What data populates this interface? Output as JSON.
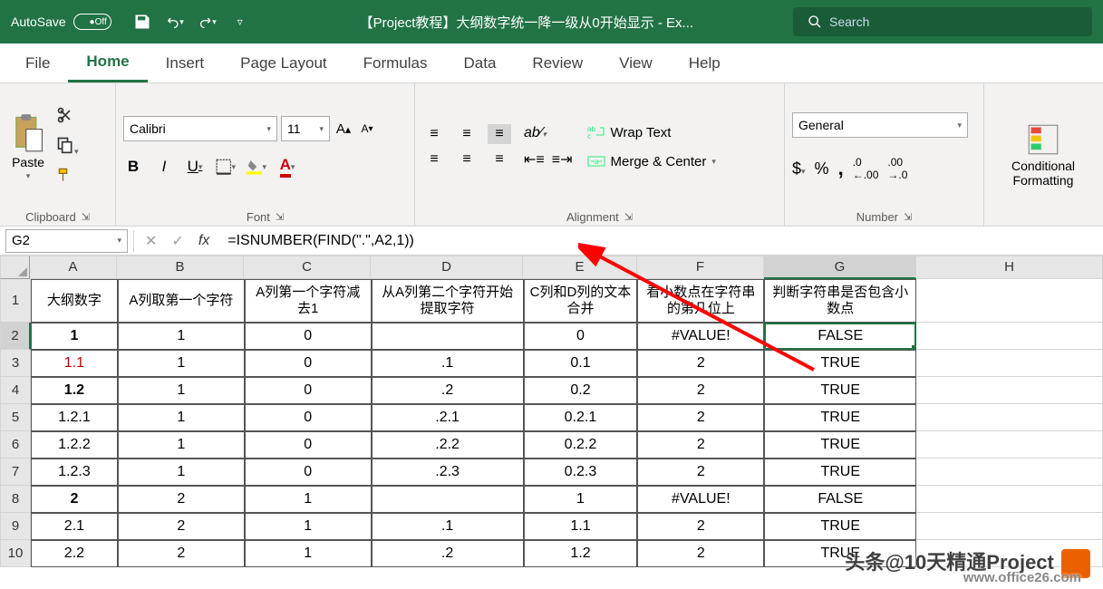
{
  "titlebar": {
    "autosave_label": "AutoSave",
    "autosave_state": "Off",
    "document_title": "【Project教程】大纲数字统一降一级从0开始显示 - Ex...",
    "search_placeholder": "Search"
  },
  "tabs": {
    "file": "File",
    "home": "Home",
    "insert": "Insert",
    "page_layout": "Page Layout",
    "formulas": "Formulas",
    "data": "Data",
    "review": "Review",
    "view": "View",
    "help": "Help"
  },
  "ribbon": {
    "clipboard": {
      "label": "Clipboard",
      "paste": "Paste"
    },
    "font": {
      "label": "Font",
      "name": "Calibri",
      "size": "11"
    },
    "alignment": {
      "label": "Alignment",
      "wrap": "Wrap Text",
      "merge": "Merge & Center"
    },
    "number": {
      "label": "Number",
      "format": "General"
    },
    "styles": {
      "conditional": "Conditional Formatting"
    }
  },
  "formula_bar": {
    "name_box": "G2",
    "formula": "=ISNUMBER(FIND(\".\",A2,1))"
  },
  "columns": {
    "widths": [
      96,
      140,
      140,
      168,
      126,
      140,
      168,
      206
    ],
    "labels": [
      "A",
      "B",
      "C",
      "D",
      "E",
      "F",
      "G",
      "H"
    ]
  },
  "headers": [
    "大纲数字",
    "A列取第一个字符",
    "A列第一个字符减去1",
    "从A列第二个字符开始提取字符",
    "C列和D列的文本合并",
    "看小数点在字符串的第几位上",
    "判断字符串是否包含小数点"
  ],
  "rows": [
    {
      "n": "2",
      "bold": true,
      "red": false,
      "a": "1",
      "b": "1",
      "c": "0",
      "d": "",
      "e": "0",
      "f": "#VALUE!",
      "g": "FALSE",
      "sel": true
    },
    {
      "n": "3",
      "bold": false,
      "red": true,
      "a": "1.1",
      "b": "1",
      "c": "0",
      "d": ".1",
      "e": "0.1",
      "f": "2",
      "g": "TRUE"
    },
    {
      "n": "4",
      "bold": true,
      "red": false,
      "a": "1.2",
      "b": "1",
      "c": "0",
      "d": ".2",
      "e": "0.2",
      "f": "2",
      "g": "TRUE"
    },
    {
      "n": "5",
      "bold": false,
      "red": false,
      "a": "1.2.1",
      "b": "1",
      "c": "0",
      "d": ".2.1",
      "e": "0.2.1",
      "f": "2",
      "g": "TRUE"
    },
    {
      "n": "6",
      "bold": false,
      "red": false,
      "a": "1.2.2",
      "b": "1",
      "c": "0",
      "d": ".2.2",
      "e": "0.2.2",
      "f": "2",
      "g": "TRUE"
    },
    {
      "n": "7",
      "bold": false,
      "red": false,
      "a": "1.2.3",
      "b": "1",
      "c": "0",
      "d": ".2.3",
      "e": "0.2.3",
      "f": "2",
      "g": "TRUE"
    },
    {
      "n": "8",
      "bold": true,
      "red": false,
      "a": "2",
      "b": "2",
      "c": "1",
      "d": "",
      "e": "1",
      "f": "#VALUE!",
      "g": "FALSE"
    },
    {
      "n": "9",
      "bold": false,
      "red": false,
      "a": "2.1",
      "b": "2",
      "c": "1",
      "d": ".1",
      "e": "1.1",
      "f": "2",
      "g": "TRUE"
    },
    {
      "n": "10",
      "bold": false,
      "red": false,
      "a": "2.2",
      "b": "2",
      "c": "1",
      "d": ".2",
      "e": "1.2",
      "f": "2",
      "g": "TRUE"
    }
  ],
  "watermark": {
    "text": "头条@10天精通Project",
    "url": "www.office26.com"
  }
}
